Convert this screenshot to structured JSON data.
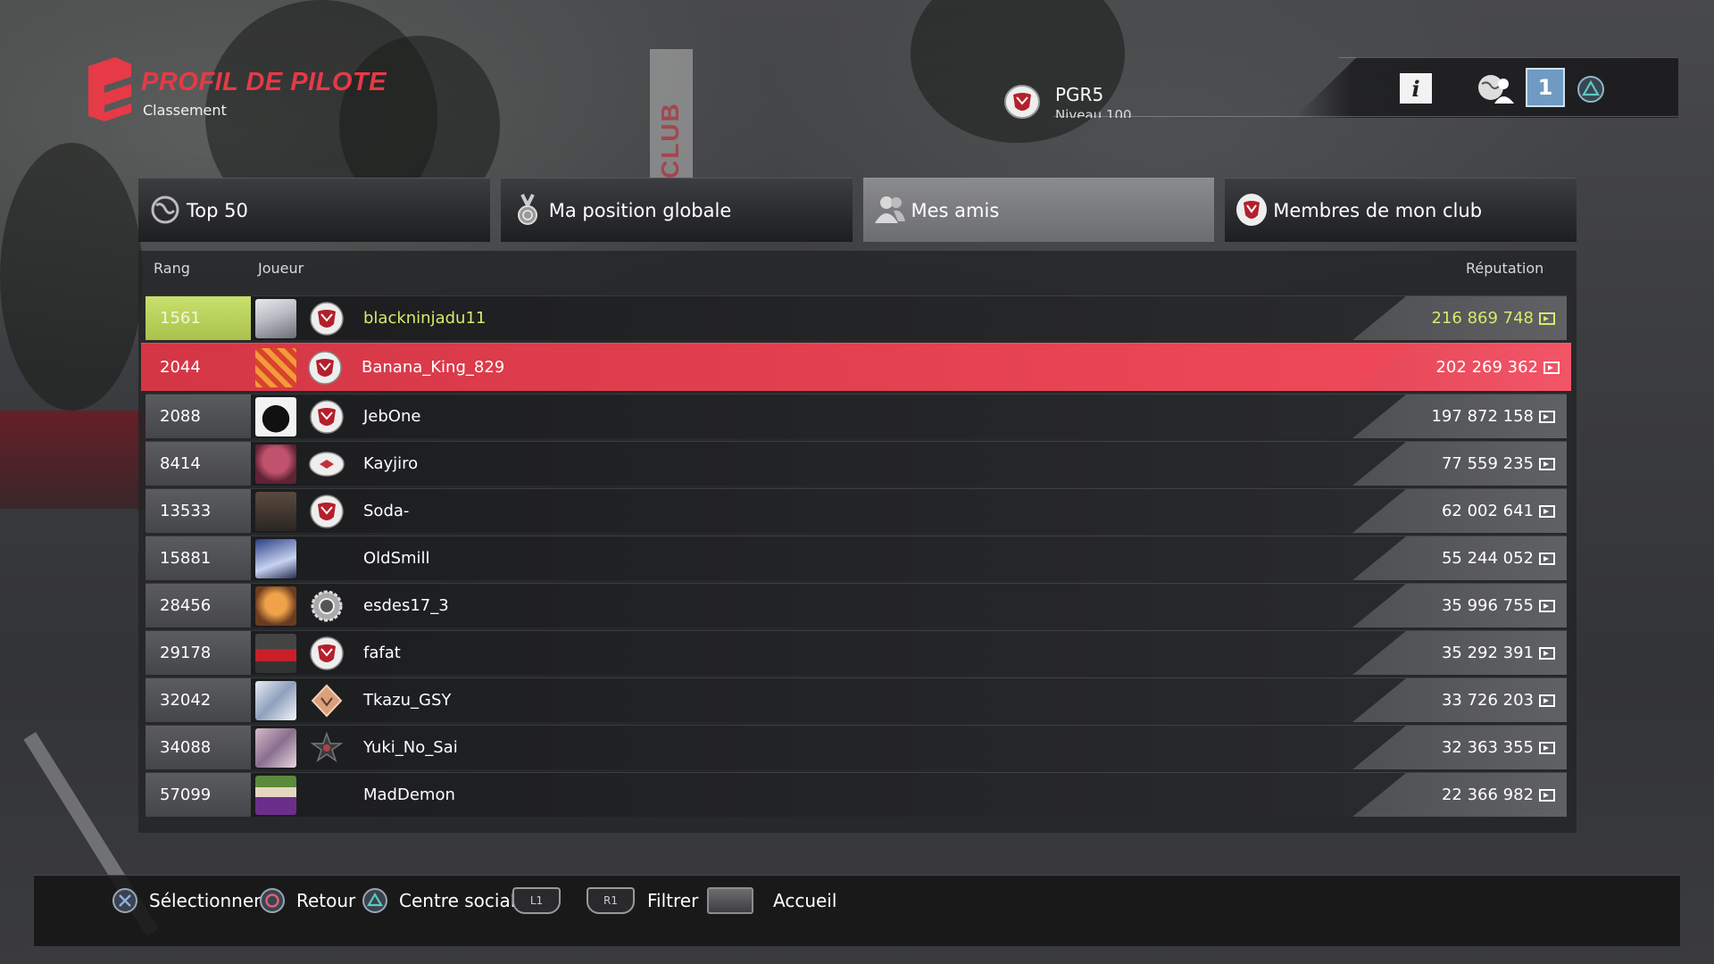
{
  "header": {
    "title": "PROFIL DE PILOTE",
    "subtitle": "Classement",
    "brand_color": "#e63a46"
  },
  "background": {
    "banner_text": "CLUB"
  },
  "topbar": {
    "player_name": "PGR5",
    "player_level": "Niveau 100",
    "info_label": "i",
    "notification_count": "1",
    "accent": "#6f9ac2"
  },
  "tabs": [
    {
      "label": "Top 50",
      "icon": "globe-icon"
    },
    {
      "label": "Ma position globale",
      "icon": "medal-icon"
    },
    {
      "label": "Mes amis",
      "icon": "friends-icon"
    },
    {
      "label": "Membres de mon club",
      "icon": "club-badge-icon"
    }
  ],
  "active_tab": "Mes amis",
  "table": {
    "col_rank": "Rang",
    "col_player": "Joueur",
    "col_reputation": "Réputation",
    "rows": [
      {
        "rank": "1561",
        "name": "blackninjadu11",
        "reputation": "216 869 748",
        "club": "red-shield",
        "avatar": "white-haired-woman",
        "highlight": "me"
      },
      {
        "rank": "2044",
        "name": "Banana_King_829",
        "reputation": "202 269 362",
        "club": "red-shield",
        "avatar": "orange-pattern",
        "highlight": "selected"
      },
      {
        "rank": "2088",
        "name": "JebOne",
        "reputation": "197 872 158",
        "club": "red-shield",
        "avatar": "black-cat"
      },
      {
        "rank": "8414",
        "name": "Kayjiro",
        "reputation": "77 559 235",
        "club": "white-oval",
        "avatar": "pink-hood"
      },
      {
        "rank": "13533",
        "name": "Soda-",
        "reputation": "62 002 641",
        "club": "red-shield",
        "avatar": "gunman"
      },
      {
        "rank": "15881",
        "name": "OldSmill",
        "reputation": "55 244 052",
        "club": "",
        "avatar": "blue-figure"
      },
      {
        "rank": "28456",
        "name": "esdes17_3",
        "reputation": "35 996 755",
        "club": "silver-gear",
        "avatar": "orange-character"
      },
      {
        "rank": "29178",
        "name": "fafat",
        "reputation": "35 292 391",
        "club": "red-shield",
        "avatar": "red-car"
      },
      {
        "rank": "32042",
        "name": "Tkazu_GSY",
        "reputation": "33 726 203",
        "club": "orange-diamond",
        "avatar": "crystal"
      },
      {
        "rank": "34088",
        "name": "Yuki_No_Sai",
        "reputation": "32 363 355",
        "club": "dark-star",
        "avatar": "pink-art"
      },
      {
        "rank": "57099",
        "name": "MadDemon",
        "reputation": "22 366 982",
        "club": "",
        "avatar": "joker"
      }
    ]
  },
  "footer": {
    "select": "Sélectionner",
    "back": "Retour",
    "social": "Centre social",
    "l1": "L1",
    "r1": "R1",
    "filter": "Filtrer",
    "home": "Accueil"
  },
  "colors": {
    "selected_row": "#f24b5b",
    "own_row_rank": "#c8e06c",
    "own_row_text": "#d7ea6a"
  }
}
